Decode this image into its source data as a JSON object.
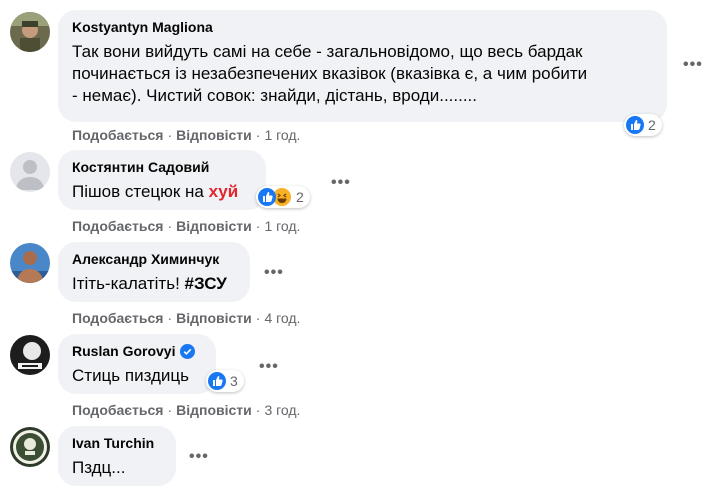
{
  "comments": [
    {
      "author": "Kostyantyn Magliona",
      "lines": [
        "Так вони вийдуть самі на себе - загальновідомо, що весь бардак",
        "починається із незабезпечених вказівок (вказівка є, а чим робити",
        "- немає). Чистий совок: знайди, дістань, вроди........"
      ],
      "like_label": "Подобається",
      "reply_label": "Відповісти",
      "time": "1 год.",
      "reaction_count": "2",
      "reaction_icons": [
        "like-icon"
      ]
    },
    {
      "author": "Костянтин Садовий",
      "text": "Пішов стецюк на ",
      "censored": "хуй",
      "like_label": "Подобається",
      "reply_label": "Відповісти",
      "time": "1 год.",
      "reaction_count": "2",
      "reaction_icons": [
        "like-icon",
        "haha-icon"
      ]
    },
    {
      "author": "Александр Химинчук",
      "text": "Ітіть-калатіть! ",
      "hashtag": "#ЗСУ",
      "like_label": "Подобається",
      "reply_label": "Відповісти",
      "time": "4 год."
    },
    {
      "author": "Ruslan Gorovyi",
      "verified": true,
      "text": "Стиць пиздиць",
      "like_label": "Подобається",
      "reply_label": "Відповісти",
      "time": "3 год.",
      "reaction_count": "3",
      "reaction_icons": [
        "like-icon"
      ]
    },
    {
      "author": "Ivan Turchin",
      "text": "Пздц..."
    }
  ],
  "colors": {
    "bubble": "#f0f2f5",
    "meta": "#65676b",
    "like_blue": "#1877f2",
    "censor_red": "#e4252d"
  }
}
